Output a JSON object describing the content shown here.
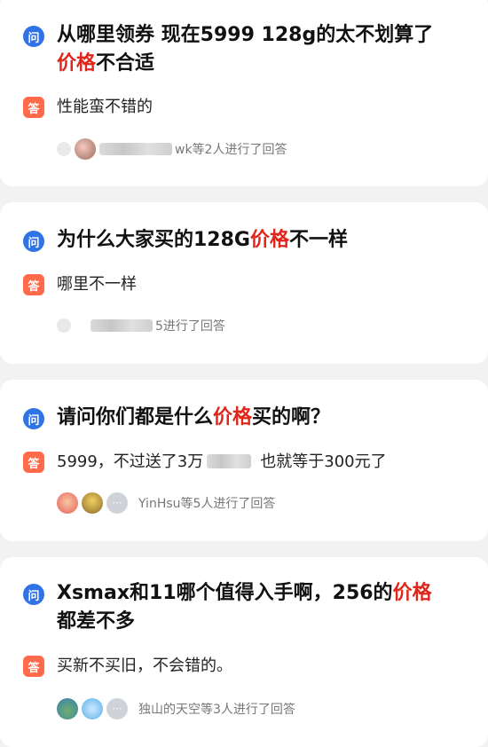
{
  "cards": [
    {
      "question_parts": [
        "从哪里领券 现在5999 128g的太不划算了",
        "价格",
        "不合适"
      ],
      "answer": "性能蛮不错的",
      "responders_suffix": "wk等2人进行了回答"
    },
    {
      "question_parts": [
        "为什么大家买的128G",
        "价格",
        "不一样"
      ],
      "answer": "哪里不一样",
      "responders_suffix": "5进行了回答"
    },
    {
      "question_parts": [
        "请问你们都是什么",
        "价格",
        "买的啊？"
      ],
      "answer_parts": [
        "5999，不过送了3万",
        "也就等于300元了"
      ],
      "responders_suffix": "YinHsu等5人进行了回答"
    },
    {
      "question_parts": [
        "Xsmax和11哪个值得入手啊，256的",
        "价格",
        "都差不多"
      ],
      "answer": "买新不买旧，不会错的。",
      "responders_suffix": "独山的天空等3人进行了回答"
    }
  ],
  "labels": {
    "question_badge": "问",
    "answer_badge": "答",
    "more_avatar": "···"
  },
  "colors": {
    "question_badge": "#2f73e6",
    "answer_badge": "#ff6a4a",
    "highlight": "#e0261b"
  }
}
